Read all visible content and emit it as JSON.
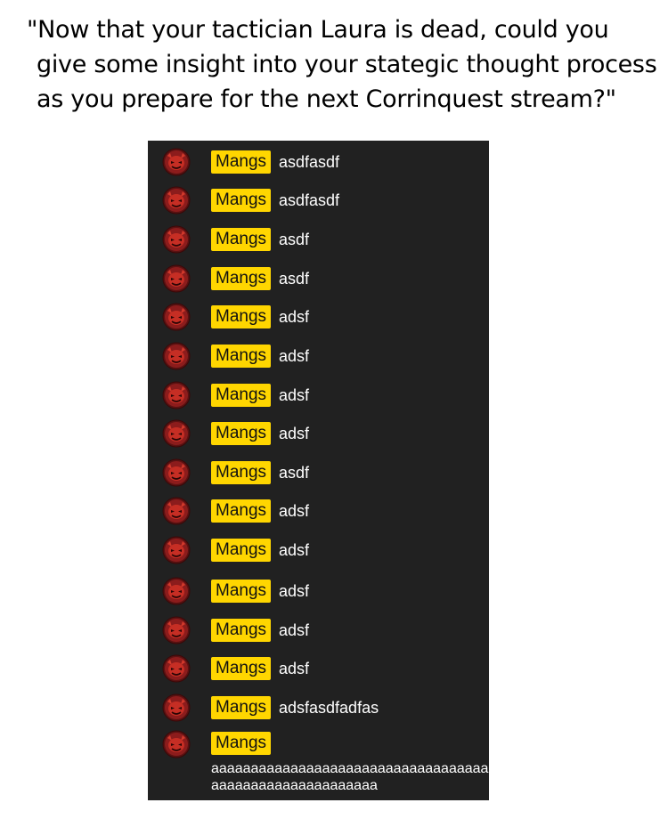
{
  "caption": {
    "line1": "\"Now that your tactician Laura is dead, could you",
    "line2": "give some insight into your stategic thought process",
    "line3": "as you prepare for the next Corrinquest stream?\""
  },
  "chat": {
    "badge_color": "#ffd600",
    "background_color": "#212121",
    "avatar_icon": "red-demon-avatar-icon",
    "messages": [
      {
        "author": "Mangs",
        "text": "asdfasdf"
      },
      {
        "author": "Mangs",
        "text": "asdfasdf"
      },
      {
        "author": "Mangs",
        "text": "asdf"
      },
      {
        "author": "Mangs",
        "text": "asdf"
      },
      {
        "author": "Mangs",
        "text": "adsf"
      },
      {
        "author": "Mangs",
        "text": "adsf"
      },
      {
        "author": "Mangs",
        "text": "adsf"
      },
      {
        "author": "Mangs",
        "text": "adsf"
      },
      {
        "author": "Mangs",
        "text": "asdf"
      },
      {
        "author": "Mangs",
        "text": "adsf"
      },
      {
        "author": "Mangs",
        "text": "adsf"
      },
      {
        "author": "Mangs",
        "text": "adsf"
      },
      {
        "author": "Mangs",
        "text": "adsf"
      },
      {
        "author": "Mangs",
        "text": "adsf"
      },
      {
        "author": "Mangs",
        "text": "adsfasdfadfas"
      }
    ],
    "last_message": {
      "author": "Mangs",
      "line1": "aaaaaaaaaaaaaaaaaaaaaaaaaaaaaaaaaaaa",
      "line2": "aaaaaaaaaaaaaaaaaaaaa"
    }
  }
}
